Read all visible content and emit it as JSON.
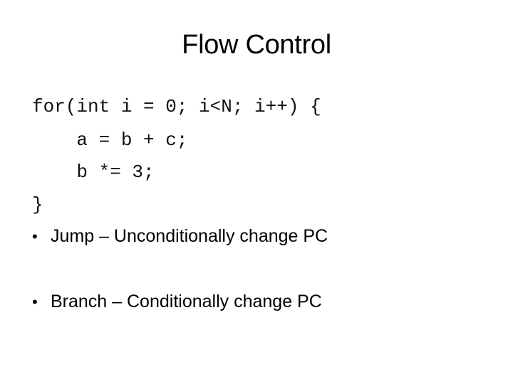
{
  "slide": {
    "title": "Flow Control",
    "code_lines": [
      "for(int i = 0; i<N; i++) {",
      "    a = b + c;",
      "    b *= 3;",
      "}"
    ],
    "bullets": [
      {
        "marker": "•",
        "text": "Jump – Unconditionally change PC"
      },
      {
        "marker": "•",
        "text": "Branch – Conditionally change PC"
      }
    ]
  }
}
